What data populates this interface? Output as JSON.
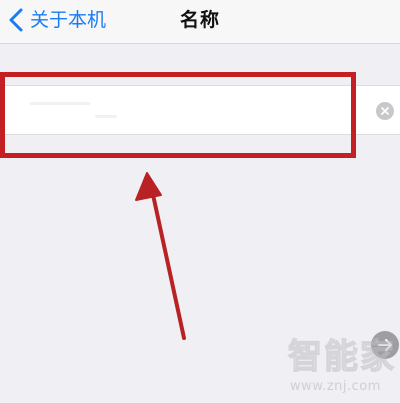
{
  "nav": {
    "back_label": "关于本机",
    "title": "名称"
  },
  "name_field": {
    "value": "",
    "clear_icon": "clear-x-icon"
  },
  "annotation": {
    "box_color": "#c41f22",
    "arrow_color": "#b82224"
  },
  "watermark": {
    "brand": "智能家",
    "url": "www.znj.com"
  },
  "colors": {
    "accent": "#1a7cf4",
    "background": "#efeff4"
  }
}
